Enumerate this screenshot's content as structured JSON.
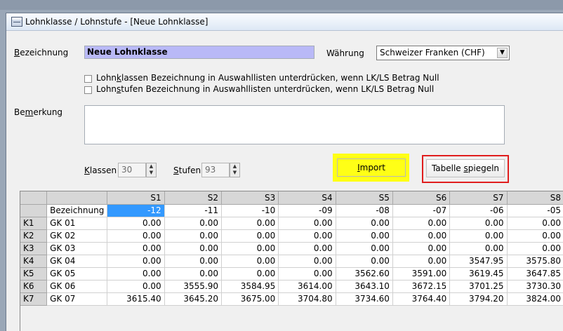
{
  "window": {
    "title": "Lohnklasse / Lohnstufe - [Neue Lohnklasse]"
  },
  "form": {
    "bezeichnung_label_u": "B",
    "bezeichnung_label_rest": "ezeichnung",
    "bezeichnung_value": "Neue Lohnklasse",
    "waehrung_label": "Währung",
    "waehrung_value": "Schweizer Franken (CHF)",
    "check1_pre": "Lohn",
    "check1_u": "k",
    "check1_post": "lassen Bezeichnung in Auswahllisten unterdrücken, wenn LK/LS Betrag Null",
    "check1_checked": false,
    "check2_pre": "Lohn",
    "check2_u": "s",
    "check2_post": "tufen Bezeichnung in Auswahllisten unterdrücken, wenn LK/LS Betrag Null",
    "check2_checked": false,
    "bemerkung_pre": "Be",
    "bemerkung_u": "m",
    "bemerkung_post": "erkung",
    "bemerkung_value": "",
    "klassen_label_u": "K",
    "klassen_label_rest": "lassen",
    "klassen_value": "30",
    "stufen_label_u": "S",
    "stufen_label_rest": "tufen",
    "stufen_value": "93",
    "import_u": "I",
    "import_rest": "mport",
    "spiegeln_pre": "Tabelle ",
    "spiegeln_u": "s",
    "spiegeln_post": "piegeln",
    "highlight_import": "#ffff16",
    "highlight_spiegeln": "#e01e1e"
  },
  "grid": {
    "columns": [
      "S1",
      "S2",
      "S3",
      "S4",
      "S5",
      "S6",
      "S7",
      "S8"
    ],
    "name_row_label": "Bezeichnung",
    "name_row": [
      "-12",
      "-11",
      "-10",
      "-09",
      "-08",
      "-07",
      "-06",
      "-05"
    ],
    "rows": [
      {
        "k": "K1",
        "name": "GK 01",
        "values": [
          "0.00",
          "0.00",
          "0.00",
          "0.00",
          "0.00",
          "0.00",
          "0.00",
          "0.00"
        ]
      },
      {
        "k": "K2",
        "name": "GK 02",
        "values": [
          "0.00",
          "0.00",
          "0.00",
          "0.00",
          "0.00",
          "0.00",
          "0.00",
          "0.00"
        ]
      },
      {
        "k": "K3",
        "name": "GK 03",
        "values": [
          "0.00",
          "0.00",
          "0.00",
          "0.00",
          "0.00",
          "0.00",
          "0.00",
          "0.00"
        ]
      },
      {
        "k": "K4",
        "name": "GK 04",
        "values": [
          "0.00",
          "0.00",
          "0.00",
          "0.00",
          "0.00",
          "0.00",
          "3547.95",
          "3575.80"
        ]
      },
      {
        "k": "K5",
        "name": "GK 05",
        "values": [
          "0.00",
          "0.00",
          "0.00",
          "0.00",
          "3562.60",
          "3591.00",
          "3619.45",
          "3647.85"
        ]
      },
      {
        "k": "K6",
        "name": "GK 06",
        "values": [
          "0.00",
          "3555.90",
          "3584.95",
          "3614.00",
          "3643.10",
          "3672.15",
          "3701.25",
          "3730.30"
        ]
      },
      {
        "k": "K7",
        "name": "GK 07",
        "values": [
          "3615.40",
          "3645.20",
          "3675.00",
          "3704.80",
          "3734.60",
          "3764.40",
          "3794.20",
          "3824.00"
        ]
      }
    ]
  }
}
